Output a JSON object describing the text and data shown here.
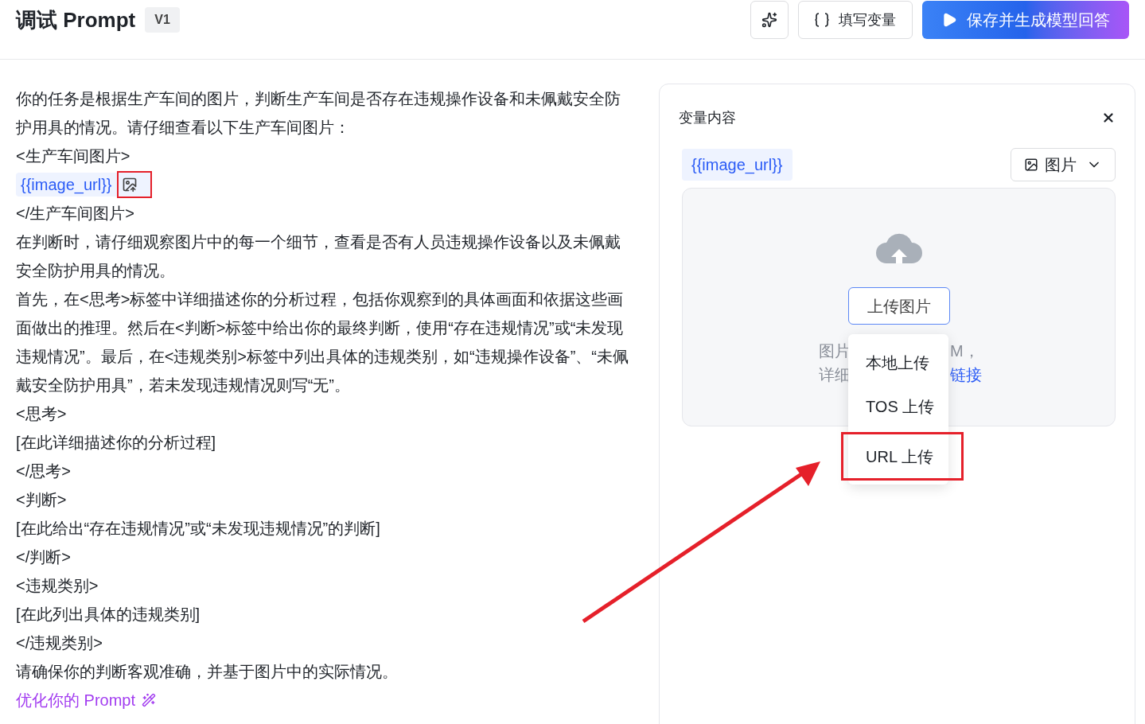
{
  "header": {
    "title": "调试 Prompt",
    "version": "V1",
    "buttons": [
      {
        "kind": "icon"
      },
      {
        "kind": "variables",
        "label": "填写变量"
      },
      {
        "kind": "primary",
        "label": "保存并生成模型回答"
      }
    ]
  },
  "prompt": {
    "lines": [
      {
        "kind": "text",
        "text": "你的任务是根据生产车间的图片，判断生产车间是否存在违规操作设备和未佩戴安全防护用具的情况。请仔细查看以下生产车间图片："
      },
      {
        "kind": "text",
        "text": "<生产车间图片>"
      },
      {
        "kind": "variable",
        "text": "{{image_url}}",
        "annotated": true
      },
      {
        "kind": "text",
        "text": "</生产车间图片>"
      },
      {
        "kind": "text",
        "text": "在判断时，请仔细观察图片中的每一个细节，查看是否有人员违规操作设备以及未佩戴安全防护用具的情况。"
      },
      {
        "kind": "text",
        "text": "首先，在<思考>标签中详细描述你的分析过程，包括你观察到的具体画面和依据这些画面做出的推理。然后在<判断>标签中给出你的最终判断，使用“存在违规情况”或“未发现违规情况”。最后，在<违规类别>标签中列出具体的违规类别，如“违规操作设备”、“未佩戴安全防护用具”，若未发现违规情况则写“无”。"
      },
      {
        "kind": "text",
        "text": "<思考>"
      },
      {
        "kind": "text",
        "text": "[在此详细描述你的分析过程]"
      },
      {
        "kind": "text",
        "text": "</思考>"
      },
      {
        "kind": "text",
        "text": "<判断>"
      },
      {
        "kind": "text",
        "text": "[在此给出“存在违规情况”或“未发现违规情况”的判断]"
      },
      {
        "kind": "text",
        "text": "</判断>"
      },
      {
        "kind": "text",
        "text": "<违规类别>"
      },
      {
        "kind": "text",
        "text": "[在此列出具体的违规类别]"
      },
      {
        "kind": "text",
        "text": "</违规类别>"
      },
      {
        "kind": "text",
        "text": "请确保你的判断客观准确，并基于图片中的实际情况。"
      }
    ],
    "optimize_link": "优化你的 Prompt"
  },
  "variable_panel": {
    "title": "变量内容",
    "variable": "{{image_url}}",
    "type_select": "图片",
    "upload_button": "上传图片",
    "hint_rows": [
      [
        "图片",
        "M，"
      ],
      [
        "详细",
        "链接"
      ]
    ],
    "menu": [
      {
        "label": "本地上传",
        "annotated": false
      },
      {
        "label": "TOS 上传",
        "annotated": false
      },
      {
        "label": "URL 上传",
        "annotated": true
      }
    ]
  }
}
